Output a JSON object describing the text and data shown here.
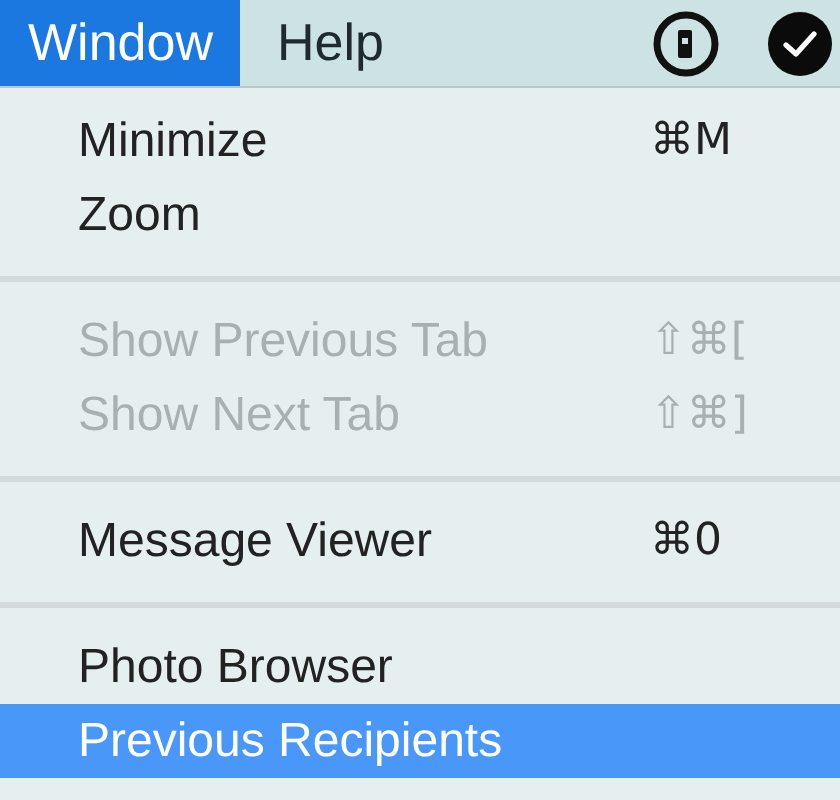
{
  "menu_bar": {
    "items": [
      {
        "label": "Window",
        "selected": true
      },
      {
        "label": "Help",
        "selected": false
      }
    ]
  },
  "menu": {
    "sections": [
      {
        "items": [
          {
            "label": "Minimize",
            "shortcut": "⌘M",
            "disabled": false,
            "selected": false
          },
          {
            "label": "Zoom",
            "disabled": false,
            "selected": false
          }
        ]
      },
      {
        "items": [
          {
            "label": "Show Previous Tab",
            "shortcut": "⇧⌘[",
            "disabled": true,
            "selected": false
          },
          {
            "label": "Show Next Tab",
            "shortcut": "⇧⌘]",
            "disabled": true,
            "selected": false
          }
        ]
      },
      {
        "items": [
          {
            "label": "Message Viewer",
            "shortcut": "⌘0",
            "disabled": false,
            "selected": false
          }
        ]
      },
      {
        "items": [
          {
            "label": "Photo Browser",
            "disabled": false,
            "selected": false
          },
          {
            "label": "Previous Recipients",
            "disabled": false,
            "selected": true
          }
        ]
      }
    ]
  }
}
